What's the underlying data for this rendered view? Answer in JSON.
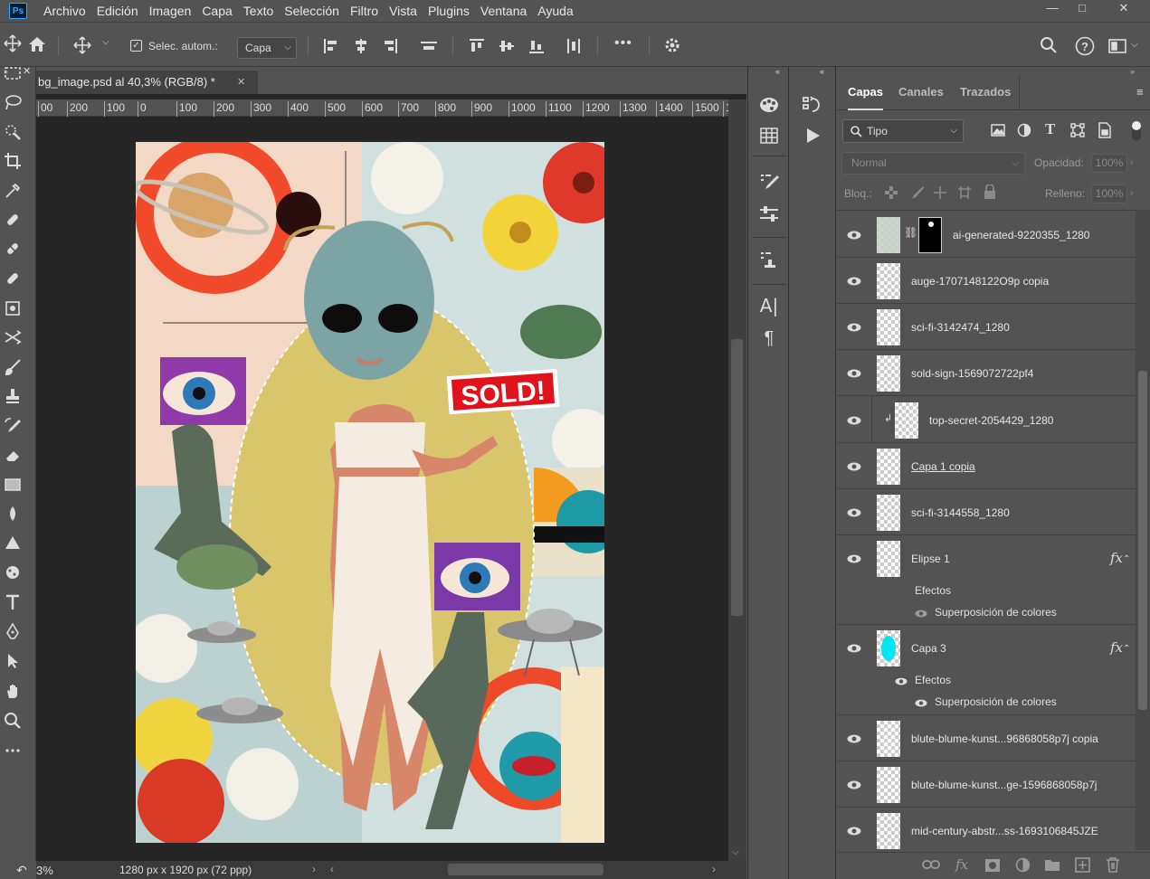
{
  "app": {
    "logo": "Ps"
  },
  "menu": [
    "Archivo",
    "Edición",
    "Imagen",
    "Capa",
    "Texto",
    "Selección",
    "Filtro",
    "Vista",
    "Plugins",
    "Ventana",
    "Ayuda"
  ],
  "window_controls": {
    "minimize": "—",
    "maximize": "□",
    "close": "✕"
  },
  "options": {
    "auto_select_label": "Selec. autom.:",
    "auto_select_checked": true,
    "target_value": "Capa",
    "more": "•••"
  },
  "document": {
    "tab_title": "bg_image.psd al 40,3% (RGB/8) *",
    "tab_close": "✕",
    "zoom": "40,3%",
    "status_zoom": "3%",
    "doc_size": "1280 px x 1920 px (72 ppp)"
  },
  "ruler": [
    "00",
    "200",
    "100",
    "0",
    "100",
    "200",
    "300",
    "400",
    "500",
    "600",
    "700",
    "800",
    "900",
    "1000",
    "1100",
    "1200",
    "1300",
    "1400",
    "1500",
    "1"
  ],
  "canvas_text": {
    "sold": "SOLD!"
  },
  "panel": {
    "tabs": [
      "Capas",
      "Canales",
      "Trazados"
    ],
    "active_tab": "Capas",
    "filter_label": "Tipo",
    "blend_mode": "Normal",
    "opacity_label": "Opacidad:",
    "opacity_value": "100%",
    "lock_label": "Bloq.:",
    "fill_label": "Relleno:",
    "fill_value": "100%"
  },
  "layers": [
    {
      "name": "ai-generated-9220355_1280",
      "visible": true,
      "mask": true,
      "fx": false
    },
    {
      "name": "auge-1707148122O9p copia",
      "visible": true,
      "mask": false,
      "fx": false
    },
    {
      "name": "sci-fi-3142474_1280",
      "visible": true,
      "mask": false,
      "fx": false
    },
    {
      "name": "sold-sign-1569072722pf4",
      "visible": true,
      "mask": false,
      "fx": false
    },
    {
      "name": "top-secret-2054429_1280",
      "visible": true,
      "mask": false,
      "fx": false,
      "clipped": true
    },
    {
      "name": "Capa 1 copia",
      "visible": true,
      "mask": false,
      "fx": false,
      "underline": true
    },
    {
      "name": "sci-fi-3144558_1280",
      "visible": true,
      "mask": false,
      "fx": false
    },
    {
      "name": "Elipse 1",
      "visible": true,
      "mask": false,
      "fx": true,
      "effects_label": "Efectos",
      "effect": "Superposición de colores"
    },
    {
      "name": "Capa 3",
      "visible": true,
      "mask": false,
      "fx": true,
      "effects_label": "Efectos",
      "effect": "Superposición de colores"
    },
    {
      "name": "blute-blume-kunst...96868058p7j copia",
      "visible": true,
      "mask": false,
      "fx": false
    },
    {
      "name": "blute-blume-kunst...ge-1596868058p7j",
      "visible": true,
      "mask": false,
      "fx": false
    },
    {
      "name": "mid-century-abstr...ss-1693106845JZE",
      "visible": true,
      "mask": false,
      "fx": false
    }
  ],
  "fx_symbol": "fx",
  "colors": {
    "ui_bg": "#535353",
    "canvas_bg": "#262626",
    "accent": "#31a8ff"
  }
}
